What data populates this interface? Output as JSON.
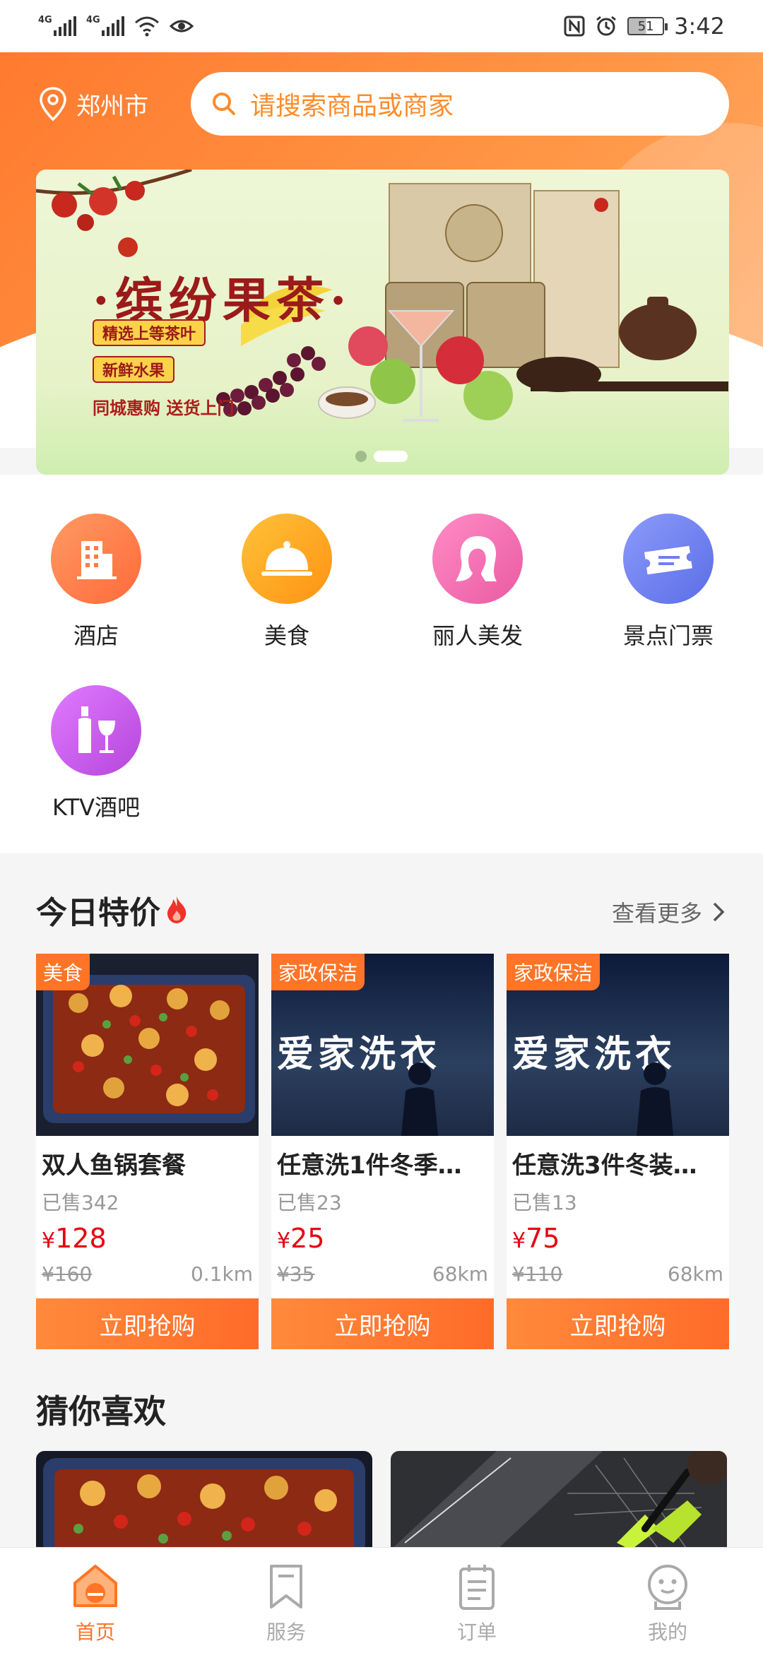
{
  "status_bar": {
    "net1": "4G",
    "net2": "4G",
    "battery": "51",
    "time": "3:42"
  },
  "header": {
    "city": "郑州市",
    "search_placeholder": "请搜索商品或商家"
  },
  "banner": {
    "title": "缤纷果茶",
    "tag1": "精选上等茶叶",
    "tag2": "新鲜水果",
    "subtitle": "同城惠购  送货上门",
    "slides": 2,
    "active_slide": 2
  },
  "categories": [
    {
      "label": "酒店",
      "icon": "hotel-icon",
      "color": "#ff7a45"
    },
    {
      "label": "美食",
      "icon": "food-cloche-icon",
      "color": "#ffa51f"
    },
    {
      "label": "丽人美发",
      "icon": "beauty-icon",
      "color": "#f36fb1"
    },
    {
      "label": "景点门票",
      "icon": "ticket-icon",
      "color": "#6e7ff0"
    },
    {
      "label": "KTV酒吧",
      "icon": "wine-icon",
      "color": "#c657e6"
    }
  ],
  "deals": {
    "title": "今日特价",
    "more": "查看更多",
    "items": [
      {
        "badge": "美食",
        "name": "双人鱼锅套餐",
        "sold": "已售342",
        "currency": "¥",
        "price": "128",
        "original": "¥160",
        "distance": "0.1km",
        "cta": "立即抢购"
      },
      {
        "badge": "家政保洁",
        "name": "任意洗1件冬季…",
        "sold": "已售23",
        "currency": "¥",
        "price": "25",
        "original": "¥35",
        "distance": "68km",
        "cta": "立即抢购",
        "img_text": "爱家洗衣"
      },
      {
        "badge": "家政保洁",
        "name": "任意洗3件冬装…",
        "sold": "已售13",
        "currency": "¥",
        "price": "75",
        "original": "¥110",
        "distance": "68km",
        "cta": "立即抢购",
        "img_text": "爱家洗衣"
      }
    ]
  },
  "guess": {
    "title": "猜你喜欢"
  },
  "nav": [
    {
      "label": "首页",
      "icon": "home-icon",
      "active": true
    },
    {
      "label": "服务",
      "icon": "bookmark-icon",
      "active": false
    },
    {
      "label": "订单",
      "icon": "clipboard-icon",
      "active": false
    },
    {
      "label": "我的",
      "icon": "profile-face-icon",
      "active": false
    }
  ],
  "colors": {
    "accent": "#ff7426",
    "price": "#e60012"
  }
}
